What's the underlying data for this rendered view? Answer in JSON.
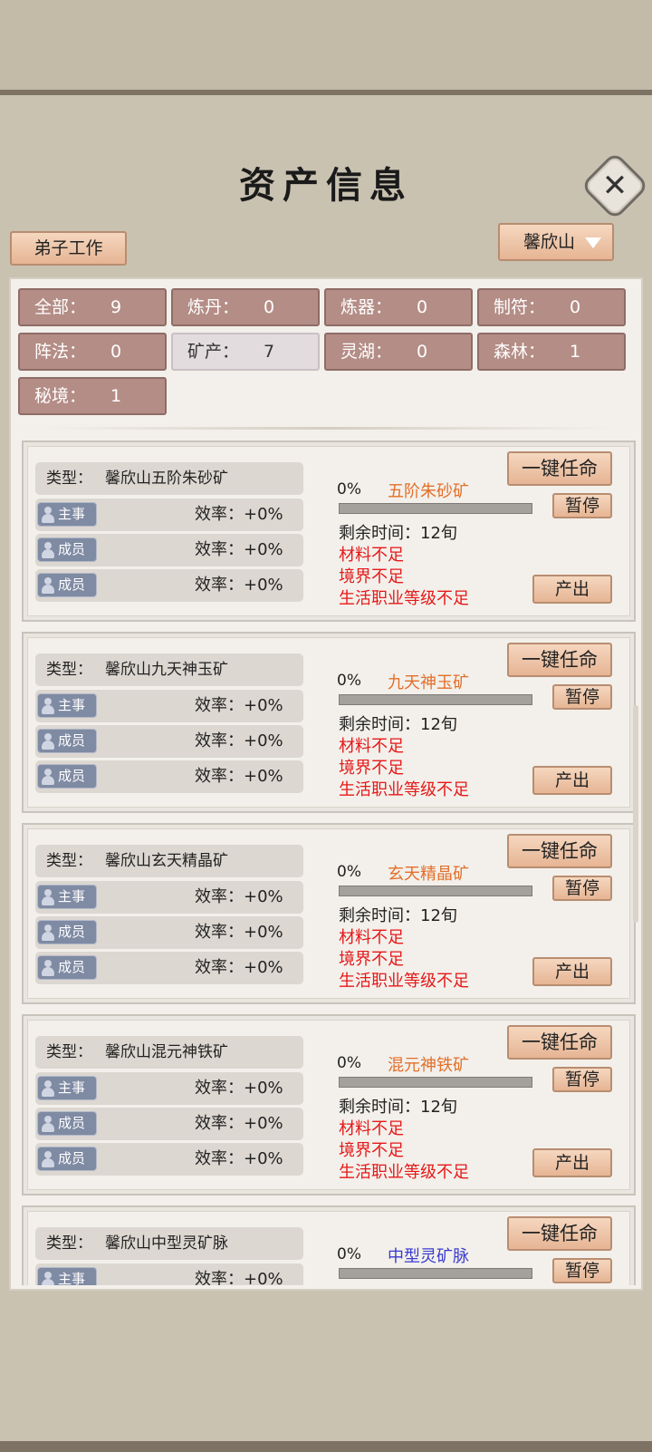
{
  "header": {
    "title": "资产信息"
  },
  "toolbar": {
    "work_button": "弟子工作",
    "sect": "馨欣山"
  },
  "filters": [
    {
      "label": "全部：",
      "count": "9"
    },
    {
      "label": "炼丹：",
      "count": "0"
    },
    {
      "label": "炼器：",
      "count": "0"
    },
    {
      "label": "制符：",
      "count": "0"
    },
    {
      "label": "阵法：",
      "count": "0"
    },
    {
      "label": "矿产：",
      "count": "7"
    },
    {
      "label": "灵湖：",
      "count": "0"
    },
    {
      "label": "森林：",
      "count": "1"
    },
    {
      "label": "秘境：",
      "count": "1"
    }
  ],
  "labels": {
    "type": "类型：",
    "leader": "主事",
    "member": "成员",
    "efficiency": "效率：+0%",
    "remaining": "剩余时间：12旬",
    "lack_material": "材料不足",
    "lack_realm": "境界不足",
    "lack_job": "生活职业等级不足",
    "appoint": "一键任命",
    "pause": "暂停",
    "output": "产出"
  },
  "mines": [
    {
      "type": "馨欣山五阶朱砂矿",
      "product": "五阶朱砂矿",
      "progress": "0%",
      "product_color": "#e36f2a"
    },
    {
      "type": "馨欣山九天神玉矿",
      "product": "九天神玉矿",
      "progress": "0%",
      "product_color": "#e36f2a"
    },
    {
      "type": "馨欣山玄天精晶矿",
      "product": "玄天精晶矿",
      "progress": "0%",
      "product_color": "#e36f2a"
    },
    {
      "type": "馨欣山混元神铁矿",
      "product": "混元神铁矿",
      "progress": "0%",
      "product_color": "#e36f2a"
    },
    {
      "type": "馨欣山中型灵矿脉",
      "product": "中型灵矿脉",
      "progress": "0%",
      "product_color": "#3a3ad0"
    }
  ]
}
